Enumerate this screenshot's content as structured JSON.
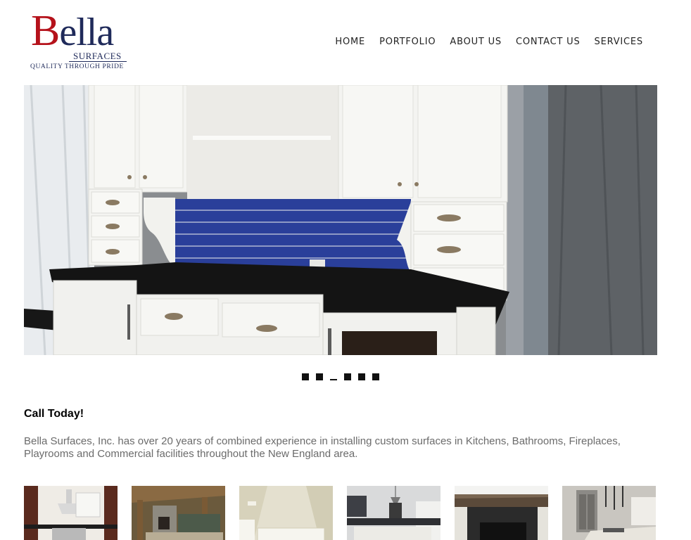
{
  "logo": {
    "name_initial": "B",
    "name_rest": "ella",
    "sub": "SURFACES",
    "tagline": "QUALITY THROUGH PRIDE"
  },
  "nav": {
    "items": [
      {
        "label": "HOME"
      },
      {
        "label": "PORTFOLIO"
      },
      {
        "label": "ABOUT US"
      },
      {
        "label": "CONTACT US"
      },
      {
        "label": "SERVICES"
      }
    ]
  },
  "slider": {
    "total": 6,
    "active_index": 2
  },
  "content": {
    "heading": "Call Today!",
    "description": "Bella Surfaces, Inc. has over 20 years of combined experience in installing custom surfaces in Kitchens, Bathrooms, Fireplaces, Playrooms and Commercial facilities throughout the New England area."
  },
  "colors": {
    "brand_red": "#b5121b",
    "brand_navy": "#1f2a5a",
    "tile_blue": "#2a3f9a",
    "body_grey": "#6b6b6b"
  }
}
